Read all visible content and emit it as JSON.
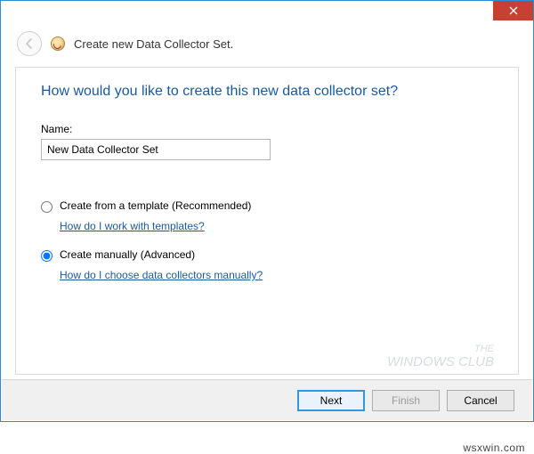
{
  "window": {
    "title": "Create new Data Collector Set."
  },
  "content": {
    "heading": "How would you like to create this new data collector set?",
    "name_label": "Name:",
    "name_value": "New Data Collector Set",
    "option_template": {
      "label": "Create from a template (Recommended)",
      "help": "How do I work with templates?",
      "selected": false
    },
    "option_manual": {
      "label": "Create manually (Advanced)",
      "help": "How do I choose data collectors manually?",
      "selected": true
    }
  },
  "footer": {
    "next": "Next",
    "finish": "Finish",
    "cancel": "Cancel"
  },
  "watermark": {
    "line1": "THE",
    "line2": "WINDOWS CLUB"
  },
  "source": "wsxwin.com"
}
